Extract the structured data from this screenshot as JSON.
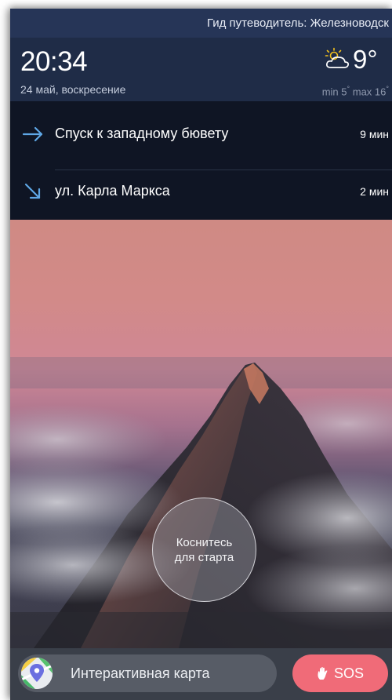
{
  "header": {
    "title": "Гид путеводитель: Железноводск"
  },
  "status": {
    "time": "20:34",
    "date": "24 май, воскресение",
    "weather_icon": "partly-cloudy-icon",
    "temperature": "9°",
    "min_label": "min 5",
    "max_label": "max 16",
    "degree_sign": "°"
  },
  "routes": [
    {
      "name": "Спуск к западному бювету",
      "time": "9 мин",
      "icon": "arrow-right-icon"
    },
    {
      "name": "ул. Карла Маркса",
      "time": "2 мин",
      "icon": "arrow-down-right-icon"
    }
  ],
  "start": {
    "line1": "Коснитесь",
    "line2": "для старта"
  },
  "bottom": {
    "map_label": "Интерактивная карта",
    "sos_label": "SOS"
  },
  "colors": {
    "title_bar": "#263557",
    "info_bar": "#1f2c47",
    "route_bg": "#0f1524",
    "accent_arrow": "#5fa7e6",
    "sos": "#f06b78",
    "weather_sun": "#f2c11d"
  }
}
